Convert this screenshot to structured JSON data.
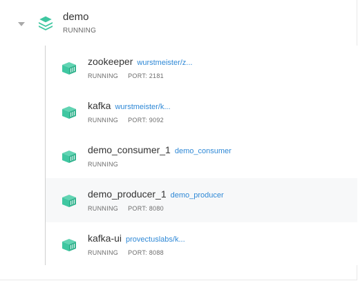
{
  "stack": {
    "name": "demo",
    "status": "RUNNING",
    "icon": "stack-icon",
    "accent": "#3fc7a1"
  },
  "containers": [
    {
      "name": "zookeeper",
      "image": "wurstmeister/z...",
      "status": "RUNNING",
      "port": "PORT: 2181"
    },
    {
      "name": "kafka",
      "image": "wurstmeister/k...",
      "status": "RUNNING",
      "port": "PORT: 9092"
    },
    {
      "name": "demo_consumer_1",
      "image": "demo_consumer",
      "status": "RUNNING",
      "port": ""
    },
    {
      "name": "demo_producer_1",
      "image": "demo_producer",
      "status": "RUNNING",
      "port": "PORT: 8080"
    },
    {
      "name": "kafka-ui",
      "image": "provectuslabs/k...",
      "status": "RUNNING",
      "port": "PORT: 8088"
    }
  ],
  "colors": {
    "link": "#2e88d6",
    "container_icon": "#3fc7a1"
  }
}
